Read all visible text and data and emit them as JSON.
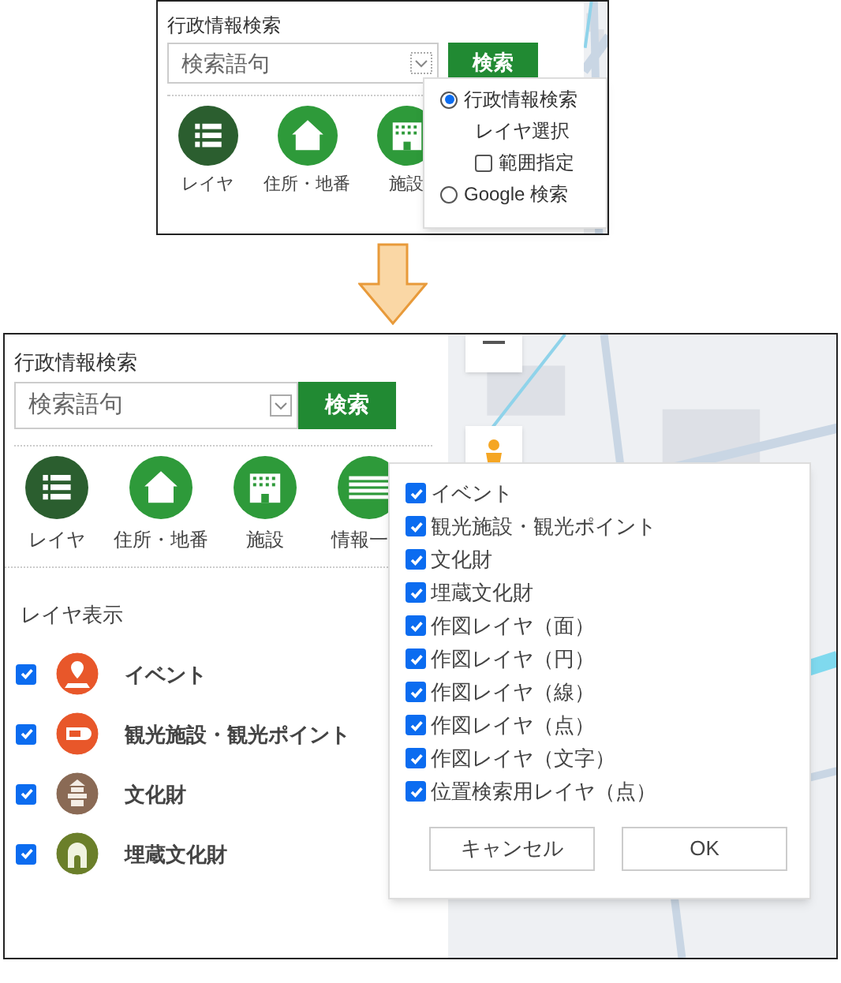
{
  "top_screenshot": {
    "panel_title": "行政情報検索",
    "search": {
      "placeholder": "検索語句"
    },
    "search_button": "検索",
    "tools": [
      {
        "kind": "layers",
        "label": "レイヤ",
        "selected": true
      },
      {
        "kind": "address",
        "label": "住所・地番",
        "selected": false
      },
      {
        "kind": "facility",
        "label": "施設",
        "selected": false
      }
    ],
    "search_mode_menu": [
      {
        "kind": "radio",
        "label": "行政情報検索",
        "selected": true
      },
      {
        "kind": "text",
        "label": "レイヤ選択"
      },
      {
        "kind": "checkbox",
        "label": "範囲指定",
        "checked": false
      },
      {
        "kind": "radio",
        "label": "Google 検索",
        "selected": false
      }
    ]
  },
  "bottom_screenshot": {
    "panel_title": "行政情報検索",
    "search": {
      "placeholder": "検索語句"
    },
    "search_button": "検索",
    "tools": [
      {
        "kind": "layers",
        "label": "レイヤ",
        "selected": true
      },
      {
        "kind": "address",
        "label": "住所・地番",
        "selected": false
      },
      {
        "kind": "facility",
        "label": "施設",
        "selected": false
      },
      {
        "kind": "info",
        "label": "情報一",
        "selected": false
      }
    ],
    "layer_section": {
      "title": "レイヤ表示",
      "layers": [
        {
          "kind": "event",
          "label": "イベント",
          "checked": true
        },
        {
          "kind": "tourism",
          "label": "観光施設・観光ポイント",
          "checked": true
        },
        {
          "kind": "cultural",
          "label": "文化財",
          "checked": true
        },
        {
          "kind": "buried",
          "label": "埋蔵文化財",
          "checked": true
        }
      ]
    },
    "layer_popup": {
      "items": [
        {
          "label": "イベント",
          "checked": true
        },
        {
          "label": "観光施設・観光ポイント",
          "checked": true
        },
        {
          "label": "文化財",
          "checked": true
        },
        {
          "label": "埋蔵文化財",
          "checked": true
        },
        {
          "label": "作図レイヤ（面）",
          "checked": true
        },
        {
          "label": "作図レイヤ（円）",
          "checked": true
        },
        {
          "label": "作図レイヤ（線）",
          "checked": true
        },
        {
          "label": "作図レイヤ（点）",
          "checked": true
        },
        {
          "label": "作図レイヤ（文字）",
          "checked": true
        },
        {
          "label": "位置検索用レイヤ（点）",
          "checked": true
        }
      ],
      "cancel_button": "キャンセル",
      "ok_button": "OK"
    }
  }
}
